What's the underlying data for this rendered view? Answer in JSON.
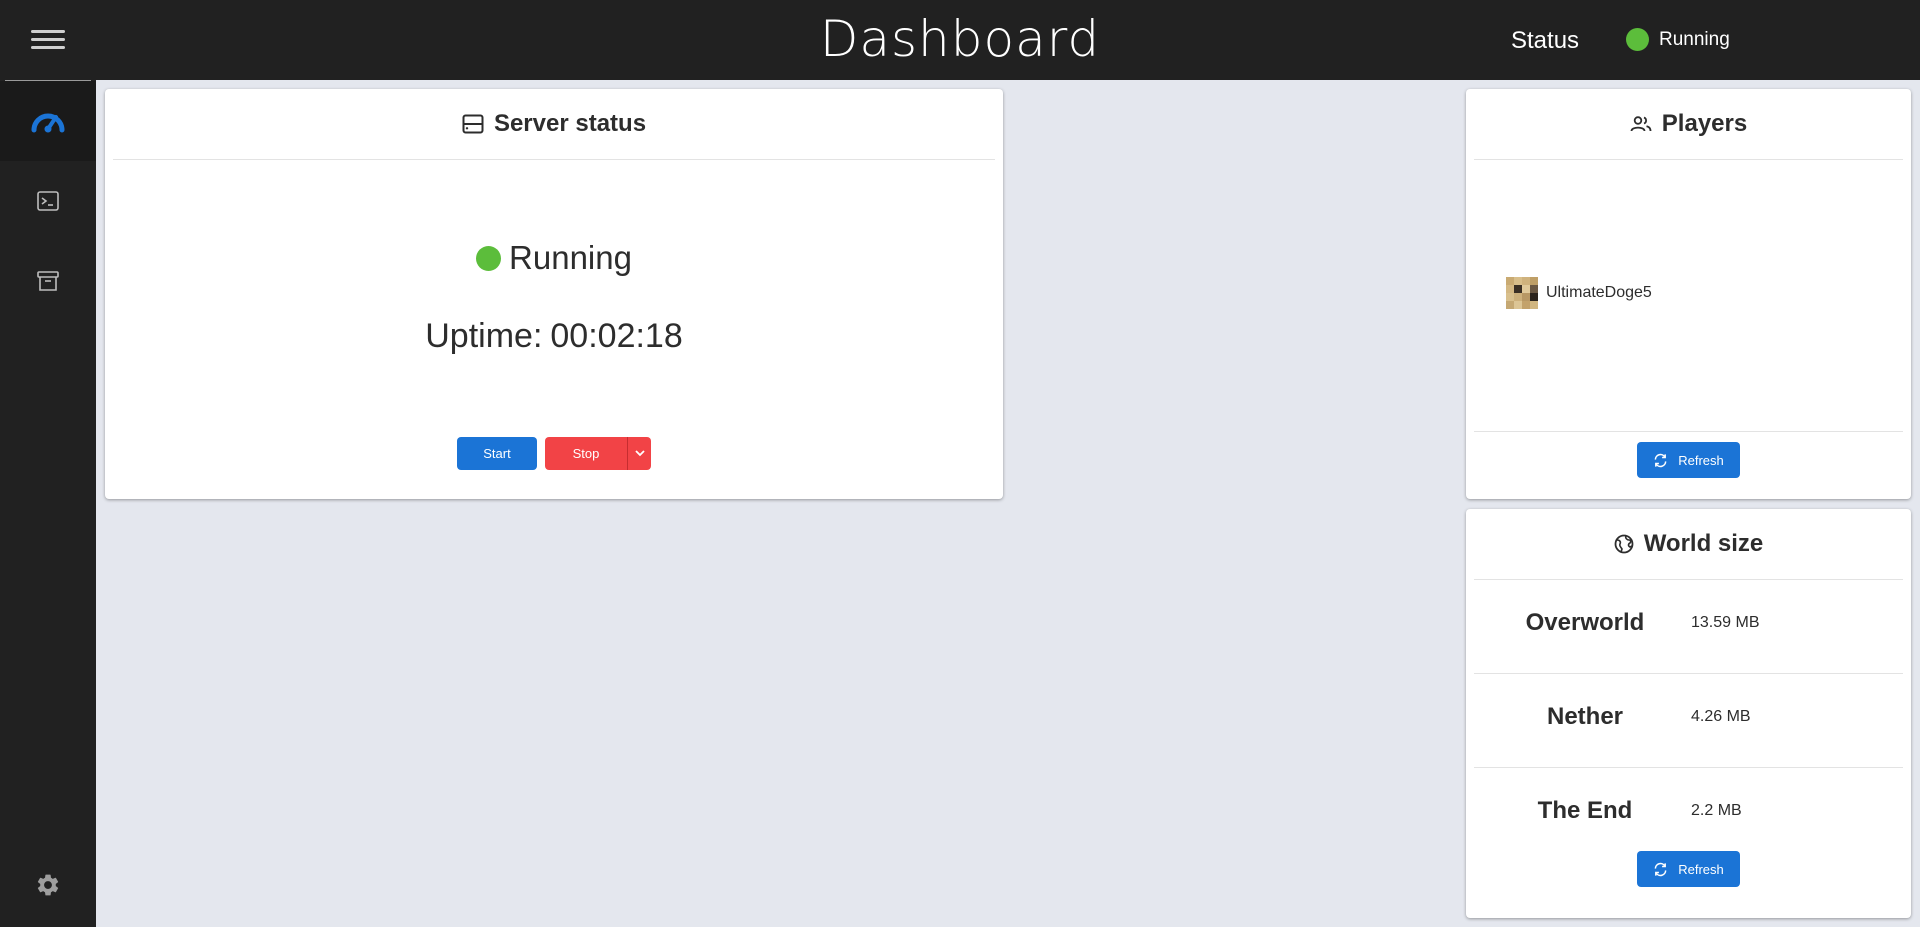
{
  "header": {
    "title": "Dashboard",
    "status_label": "Status",
    "status_value": "Running",
    "status_color": "#5cbd3b",
    "menu_icon": "hamburger-menu-icon"
  },
  "sidebar": {
    "items": [
      {
        "icon": "speedometer-icon",
        "active": true
      },
      {
        "icon": "terminal-icon",
        "active": false
      },
      {
        "icon": "archive-box-icon",
        "active": false
      }
    ],
    "footer_icon": "gear-icon",
    "accent_color": "#1b74d6"
  },
  "server_status": {
    "title": "Server status",
    "title_icon": "server-icon",
    "state": "Running",
    "uptime_label": "Uptime:",
    "uptime_value": "00:02:18",
    "start_label": "Start",
    "stop_label": "Stop",
    "caret_icon": "chevron-down-icon"
  },
  "players": {
    "title": "Players",
    "title_icon": "people-icon",
    "list": [
      {
        "name": "UltimateDoge5",
        "avatar_icon": "player-skin-avatar"
      }
    ],
    "refresh_label": "Refresh",
    "refresh_icon": "refresh-icon"
  },
  "world_size": {
    "title": "World size",
    "title_icon": "globe-icon",
    "worlds": [
      {
        "name": "Overworld",
        "size": "13.59 MB"
      },
      {
        "name": "Nether",
        "size": "4.26 MB"
      },
      {
        "name": "The End",
        "size": "2.2 MB"
      }
    ],
    "refresh_label": "Refresh",
    "refresh_icon": "refresh-icon"
  },
  "colors": {
    "background": "#e4e7ee",
    "topbar": "#212121",
    "primary": "#1b74d6",
    "danger": "#f24346",
    "running": "#5cbd3b"
  }
}
